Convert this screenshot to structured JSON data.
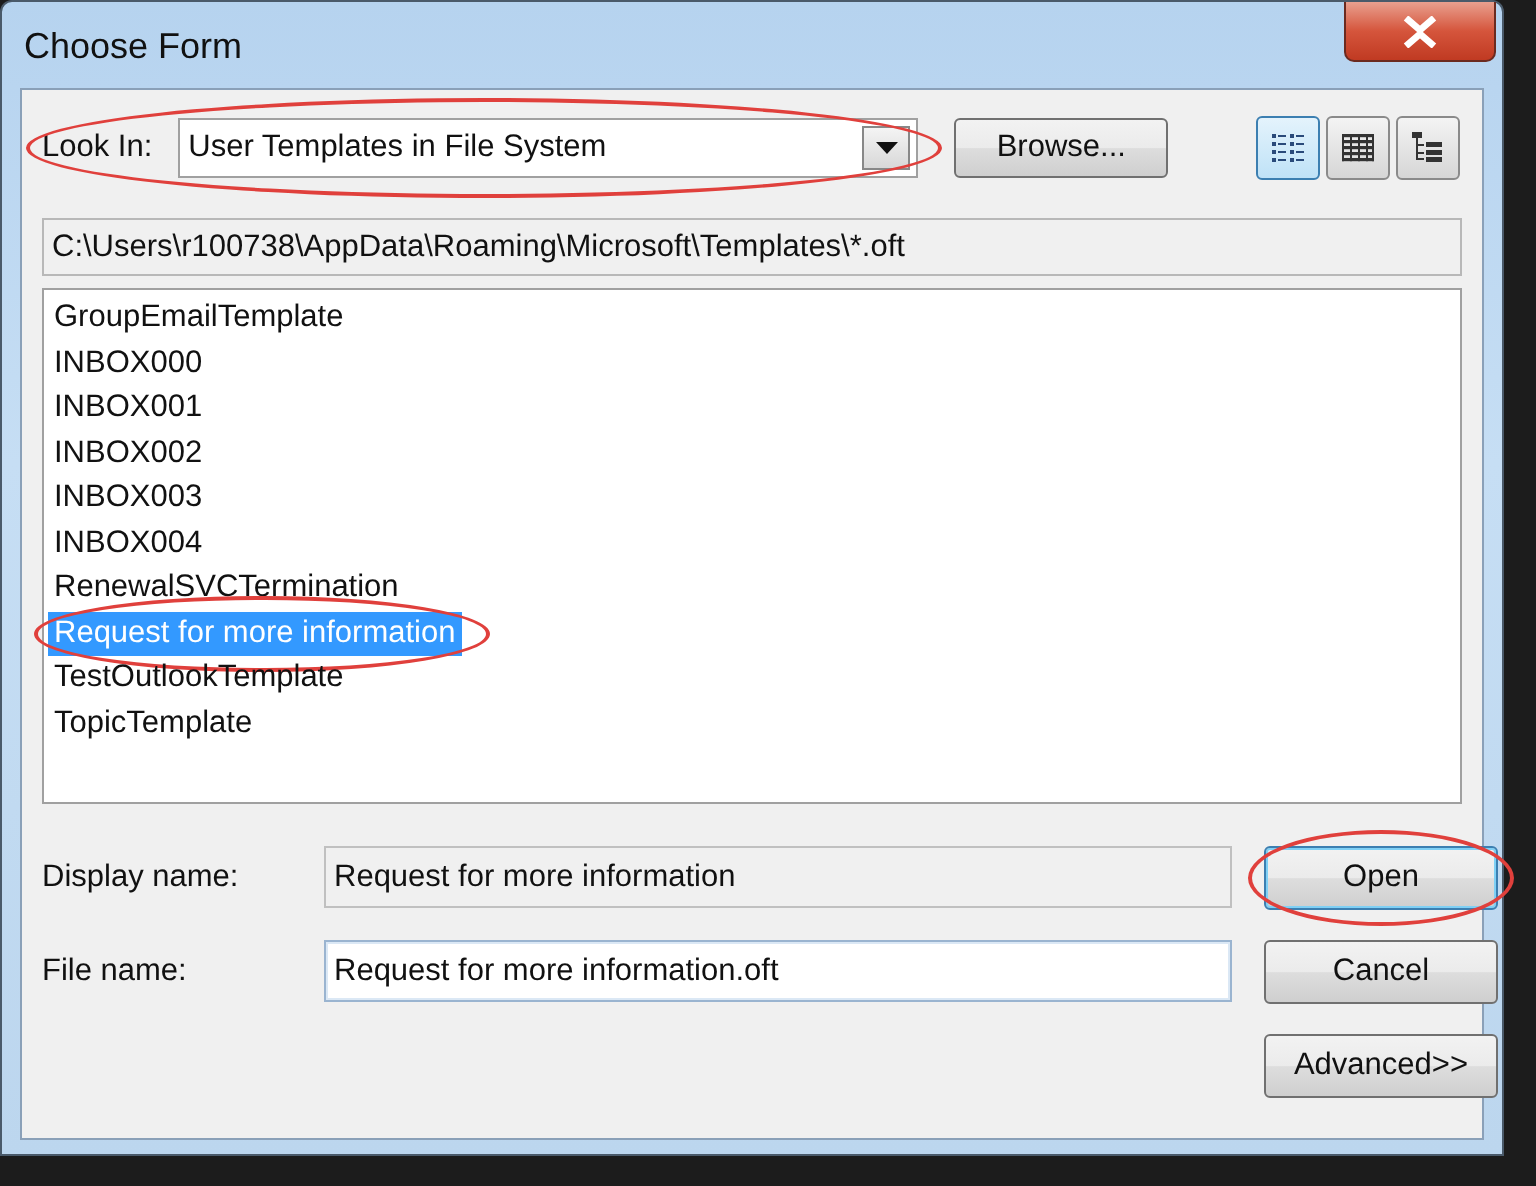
{
  "window": {
    "title": "Choose Form"
  },
  "look_in": {
    "label": "Look In:",
    "value": "User Templates in File System",
    "circled": true
  },
  "browse_button": "Browse...",
  "view_buttons": [
    {
      "kind": "list",
      "selected": true
    },
    {
      "kind": "details",
      "selected": false
    },
    {
      "kind": "tree",
      "selected": false
    }
  ],
  "path": "C:\\Users\\r100738\\AppData\\Roaming\\Microsoft\\Templates\\*.oft",
  "forms": [
    {
      "name": "GroupEmailTemplate",
      "selected": false,
      "circled": false
    },
    {
      "name": "INBOX000",
      "selected": false,
      "circled": false
    },
    {
      "name": "INBOX001",
      "selected": false,
      "circled": false
    },
    {
      "name": "INBOX002",
      "selected": false,
      "circled": false
    },
    {
      "name": "INBOX003",
      "selected": false,
      "circled": false
    },
    {
      "name": "INBOX004",
      "selected": false,
      "circled": false
    },
    {
      "name": "RenewalSVCTermination",
      "selected": false,
      "circled": false
    },
    {
      "name": "Request for more information",
      "selected": true,
      "circled": true
    },
    {
      "name": "TestOutlookTemplate",
      "selected": false,
      "circled": false
    },
    {
      "name": "TopicTemplate",
      "selected": false,
      "circled": false
    }
  ],
  "display_name": {
    "label": "Display name:",
    "value": "Request for more information",
    "readonly": true
  },
  "file_name": {
    "label": "File name:",
    "value": "Request for more information.oft",
    "readonly": false
  },
  "buttons": [
    {
      "label": "Open",
      "default": true,
      "circled": true
    },
    {
      "label": "Cancel",
      "default": false,
      "circled": false
    },
    {
      "label": "Advanced>>",
      "default": false,
      "circled": false
    }
  ]
}
